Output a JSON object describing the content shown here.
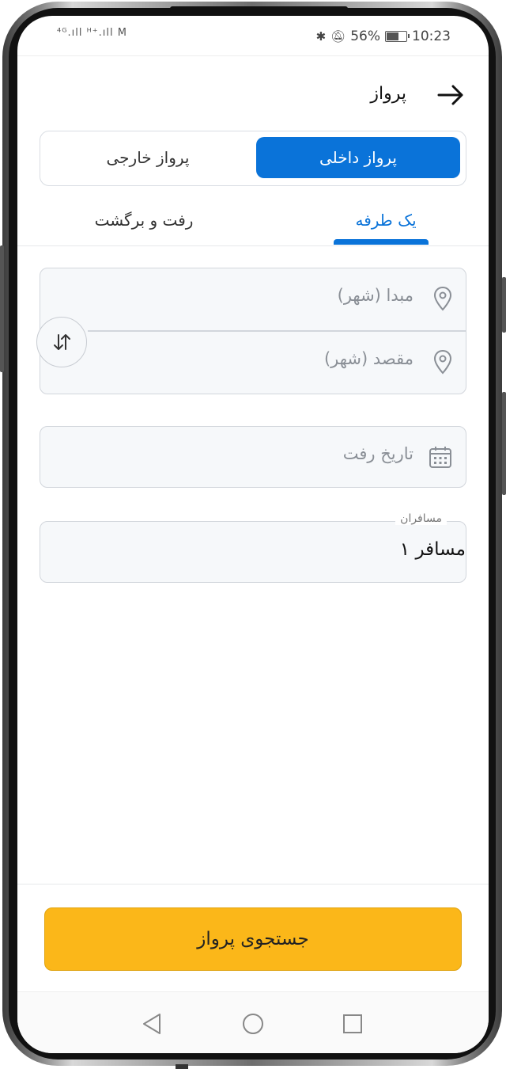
{
  "status_bar": {
    "network": "⁴ᴳ.ıll ᴴ⁺.ıll M",
    "battery": "56%",
    "time": "10:23"
  },
  "header": {
    "title": "پرواز",
    "back_icon": "arrow-right-icon"
  },
  "segment": {
    "domestic": "پرواز داخلی",
    "foreign": "پرواز خارجی",
    "selected": "domestic"
  },
  "tabs": {
    "one_way": "یک طرفه",
    "round_trip": "رفت و برگشت",
    "selected": "one_way"
  },
  "route": {
    "origin_placeholder": "مبدا (شهر)",
    "destination_placeholder": "مقصد (شهر)",
    "swap_icon": "swap-vertical-icon"
  },
  "date": {
    "placeholder": "تاریخ رفت"
  },
  "passengers": {
    "label": "مسافران",
    "value": "۱ مسافر"
  },
  "search_button": {
    "label": "جستجوی پرواز"
  },
  "colors": {
    "primary": "#0a73d9",
    "accent": "#fbb719"
  }
}
